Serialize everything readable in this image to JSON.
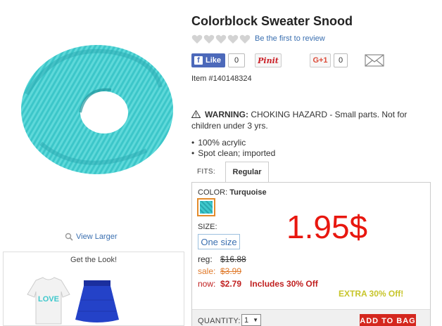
{
  "product": {
    "title": "Colorblock Sweater Snood",
    "review_link": "Be the first to review",
    "item_number": "Item #140148324",
    "view_larger": "View Larger"
  },
  "share": {
    "facebook_label": "Like",
    "facebook_count": "0",
    "pinterest_label": "Pinit",
    "gplus_label": "G+1",
    "gplus_count": "0"
  },
  "warning": {
    "heading": "WARNING:",
    "text": "CHOKING HAZARD - Small parts. Not for children under 3 yrs."
  },
  "features": [
    "100% acrylic",
    "Spot clean; imported"
  ],
  "fits": {
    "label": "FITS:",
    "selected_tab": "Regular"
  },
  "options": {
    "color_label": "COLOR:",
    "color_value": "Turquoise",
    "size_label": "SIZE:",
    "size_value": "One size"
  },
  "pricing": {
    "overlay_price": "1.95$",
    "reg_label": "reg:",
    "reg_value": "$16.88",
    "sale_label": "sale:",
    "sale_value": "$3.99",
    "now_label": "now:",
    "now_value": "$2.79",
    "now_note": "Includes 30% Off",
    "extra_off": "EXTRA 30% Off!"
  },
  "cart": {
    "qty_label": "QUANTITY:",
    "qty_value": "1",
    "add_to_bag": "ADD TO BAG"
  },
  "get_the_look": {
    "title": "Get the Look!",
    "shirt_text": "LOVE"
  },
  "colors": {
    "accent_red": "#e8170f",
    "link_blue": "#3a6fb0",
    "product_turquoise": "#3ec8cc"
  }
}
